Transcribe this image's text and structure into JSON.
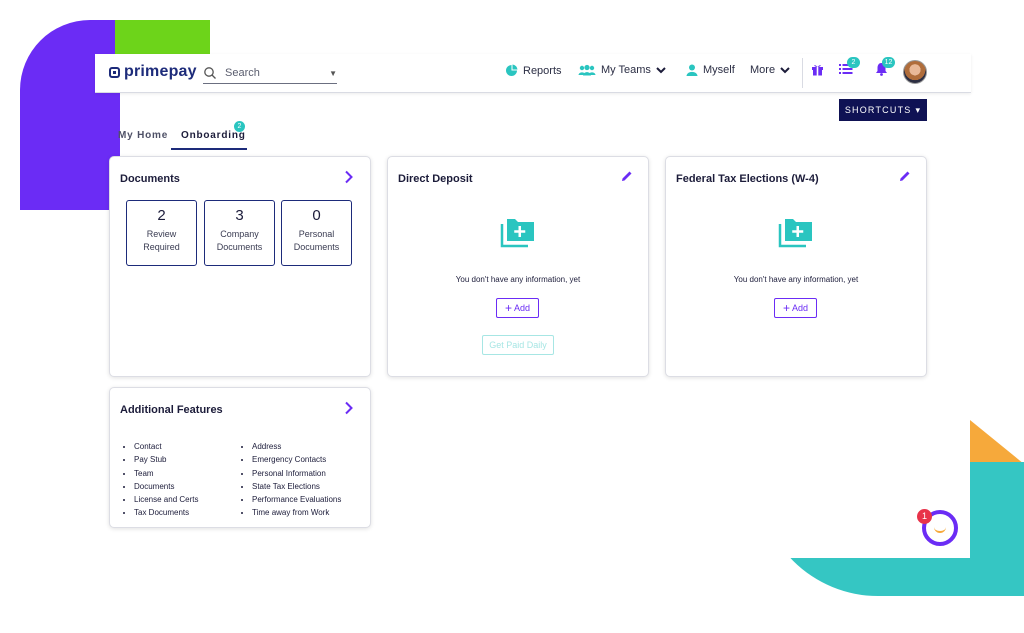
{
  "header": {
    "logo": "primepay",
    "search_placeholder": "Search",
    "nav": {
      "reports": "Reports",
      "my_teams": "My Teams",
      "myself": "Myself",
      "more": "More"
    },
    "tasks_badge": "2",
    "notifications_badge": "12"
  },
  "shortcuts_label": "SHORTCUTS",
  "tabs": {
    "home": "My Home",
    "onboarding": "Onboarding",
    "onboarding_badge": "2"
  },
  "documents": {
    "title": "Documents",
    "boxes": [
      {
        "count": "2",
        "line1": "Review",
        "line2": "Required"
      },
      {
        "count": "3",
        "line1": "Company",
        "line2": "Documents"
      },
      {
        "count": "0",
        "line1": "Personal",
        "line2": "Documents"
      }
    ]
  },
  "direct_deposit": {
    "title": "Direct Deposit",
    "empty_text": "You don't have any information, yet",
    "add_label": "Add",
    "get_paid_daily": "Get Paid Daily"
  },
  "federal_tax": {
    "title": "Federal Tax Elections (W-4)",
    "empty_text": "You don't have any information, yet",
    "add_label": "Add"
  },
  "additional_features": {
    "title": "Additional Features",
    "col1": [
      "Contact",
      "Pay Stub",
      "Team",
      "Documents",
      "License and Certs",
      "Tax Documents"
    ],
    "col2": [
      "Address",
      "Emergency Contacts",
      "Personal Information",
      "State Tax Elections",
      "Performance Evaluations",
      "Time away from Work"
    ]
  },
  "chat_badge": "1",
  "colors": {
    "brand_navy": "#1d2b7a",
    "accent_purple": "#6b2cf5",
    "teal": "#2ac5c0",
    "green": "#6dd41a",
    "orange": "#f6a93b"
  }
}
